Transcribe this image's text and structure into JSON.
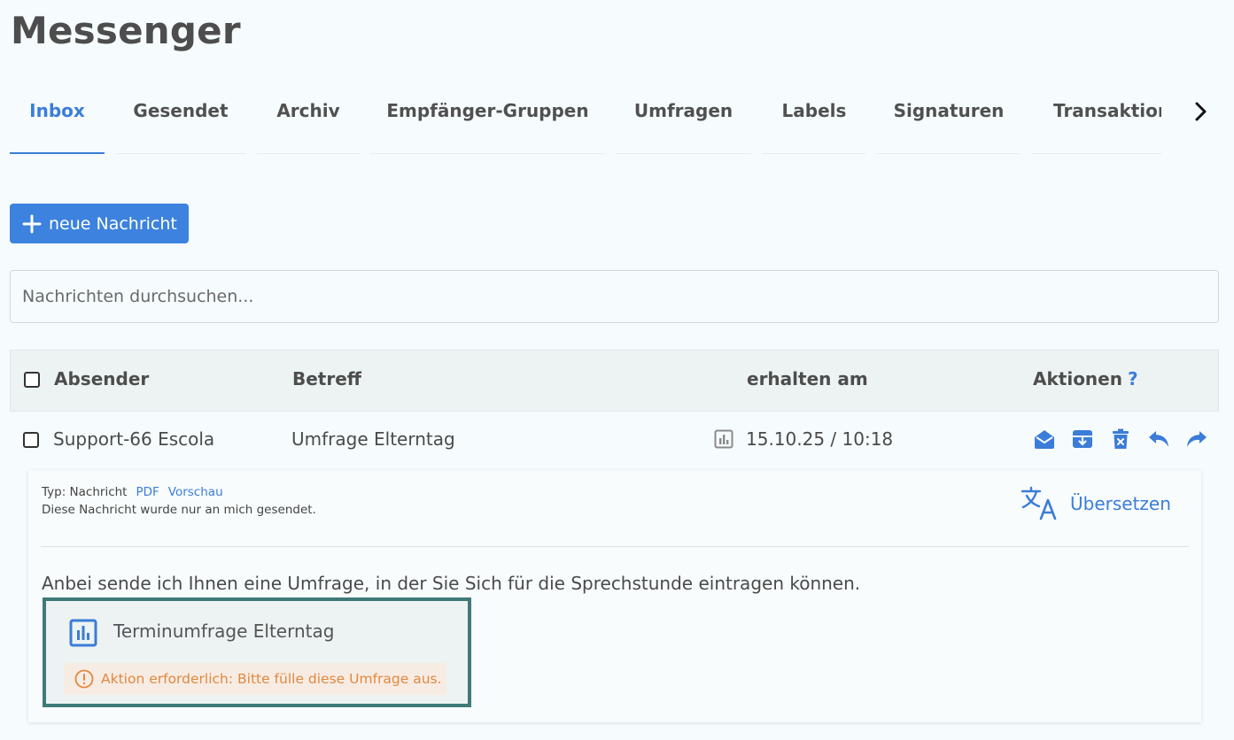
{
  "page": {
    "title": "Messenger"
  },
  "tabs": [
    {
      "label": "Inbox",
      "active": true
    },
    {
      "label": "Gesendet",
      "active": false
    },
    {
      "label": "Archiv",
      "active": false
    },
    {
      "label": "Empfänger-Gruppen",
      "active": false
    },
    {
      "label": "Umfragen",
      "active": false
    },
    {
      "label": "Labels",
      "active": false
    },
    {
      "label": "Signaturen",
      "active": false
    },
    {
      "label": "Transaktionsverlauf",
      "active": false
    }
  ],
  "actions": {
    "new_message_label": "neue Nachricht"
  },
  "search": {
    "placeholder": "Nachrichten durchsuchen..."
  },
  "table": {
    "headers": {
      "sender": "Absender",
      "subject": "Betreff",
      "received": "erhalten am",
      "actions": "Aktionen",
      "help": "?"
    },
    "rows": [
      {
        "sender": "Support-66 Escola",
        "subject": "Umfrage Elterntag",
        "received": "15.10.25 / 10:18",
        "type_icon": "poll-icon",
        "action_icons": [
          "envelope-open-icon",
          "archive-icon",
          "trash-icon",
          "reply-icon",
          "forward-icon"
        ]
      }
    ]
  },
  "detail": {
    "type_label": "Typ: Nachricht",
    "pdf_link": "PDF",
    "preview_link": "Vorschau",
    "recipient_note": "Diese Nachricht wurde nur an mich gesendet.",
    "translate_label": "Übersetzen",
    "body": "Anbei sende ich Ihnen eine Umfrage, in der Sie Sich für die Sprechstunde eintragen können.",
    "poll": {
      "title": "Terminumfrage Elterntag",
      "warning": "Aktion erforderlich: Bitte fülle diese Umfrage aus."
    }
  },
  "colors": {
    "accent": "#3b7dd8",
    "poll_border": "#3f7a78",
    "warning": "#e2883e",
    "background": "#f6fcfd"
  }
}
